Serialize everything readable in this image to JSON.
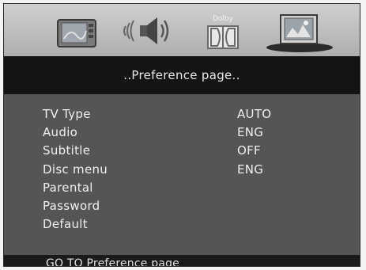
{
  "tabs": [
    {
      "icon": "tv-screen-icon",
      "selected": false
    },
    {
      "icon": "speaker-audio-icon",
      "selected": false
    },
    {
      "icon": "dolby-icon",
      "label": "Dolby",
      "selected": false
    },
    {
      "icon": "preference-picture-icon",
      "selected": true
    }
  ],
  "page_title": "..Preference page..",
  "menu": [
    {
      "label": "TV Type",
      "value": "AUTO"
    },
    {
      "label": "Audio",
      "value": "ENG"
    },
    {
      "label": "Subtitle",
      "value": "OFF"
    },
    {
      "label": "Disc menu",
      "value": "ENG"
    },
    {
      "label": "Parental",
      "value": ""
    },
    {
      "label": "Password",
      "value": ""
    },
    {
      "label": "Default",
      "value": ""
    }
  ],
  "status_text": "GO TO Preference page",
  "colors": {
    "background": "#555555",
    "title_bar": "#141414",
    "text": "#f0f0f0"
  }
}
